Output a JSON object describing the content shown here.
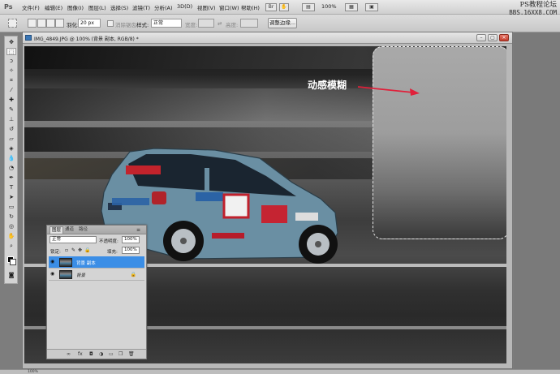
{
  "app": {
    "logo": "Ps"
  },
  "menu": [
    "文件(F)",
    "编辑(E)",
    "图像(I)",
    "图层(L)",
    "选择(S)",
    "滤镜(T)",
    "分析(A)",
    "3D(D)",
    "视图(V)",
    "窗口(W)",
    "帮助(H)"
  ],
  "menubar_zoom": "100%",
  "watermark": {
    "line1": "PS教程论坛",
    "line2": "BBS.16XX8.COM"
  },
  "options": {
    "feather_label": "羽化:",
    "feather_value": "20 px",
    "antialias_label": "消除锯齿",
    "style_label": "样式:",
    "style_value": "正常",
    "width_label": "宽度:",
    "height_label": "高度:",
    "refine_edge": "调整边缘..."
  },
  "document": {
    "title": "IMG_4849.JPG @ 100% (背景 副本, RGB/8) *",
    "annotation": "动感模糊",
    "accent_arrow_color": "#e0203a"
  },
  "layers_panel": {
    "tabs": [
      "图层",
      "通道",
      "路径"
    ],
    "blend_mode": "正常",
    "opacity_label": "不透明度:",
    "opacity_value": "100%",
    "lock_label": "锁定:",
    "fill_label": "填充:",
    "fill_value": "100%",
    "layers": [
      {
        "name": "背景 副本",
        "selected": true
      },
      {
        "name": "背景",
        "selected": false
      }
    ]
  },
  "status": {
    "zoom": "100%"
  }
}
